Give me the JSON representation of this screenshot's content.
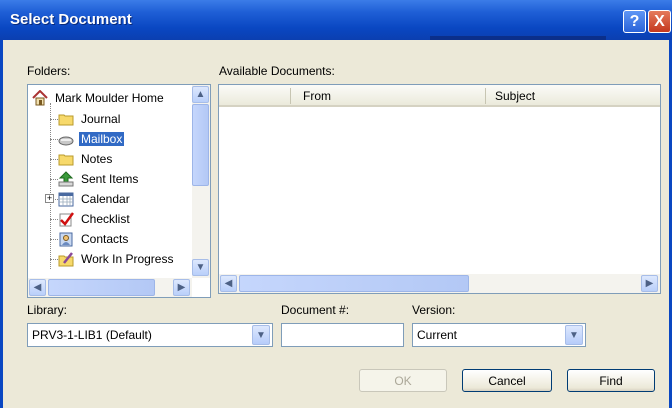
{
  "window": {
    "title": "Select Document",
    "help_glyph": "?",
    "close_glyph": "X"
  },
  "folders": {
    "label": "Folders:",
    "items": [
      {
        "label": "Mark Moulder Home",
        "icon": "home-icon"
      },
      {
        "label": "Journal",
        "icon": "folder-icon"
      },
      {
        "label": "Mailbox",
        "icon": "mailbox-icon",
        "selected": true
      },
      {
        "label": "Notes",
        "icon": "folder-icon"
      },
      {
        "label": "Sent Items",
        "icon": "sent-items-icon"
      },
      {
        "label": "Calendar",
        "icon": "calendar-icon",
        "expander": "+"
      },
      {
        "label": "Checklist",
        "icon": "checklist-icon"
      },
      {
        "label": "Contacts",
        "icon": "contacts-icon"
      },
      {
        "label": "Work In Progress",
        "icon": "work-in-progress-icon"
      }
    ]
  },
  "documents": {
    "label": "Available Documents:",
    "columns": [
      "",
      "From",
      "Subject"
    ]
  },
  "library": {
    "label": "Library:",
    "value": "PRV3-1-LIB1  (Default)"
  },
  "document_number": {
    "label": "Document #:",
    "value": ""
  },
  "version": {
    "label": "Version:",
    "value": "Current"
  },
  "buttons": {
    "ok": "OK",
    "cancel": "Cancel",
    "find": "Find"
  },
  "colors": {
    "titlebar": "#0a47c2",
    "dialog_bg": "#ece9d8",
    "selection": "#316ac5"
  }
}
